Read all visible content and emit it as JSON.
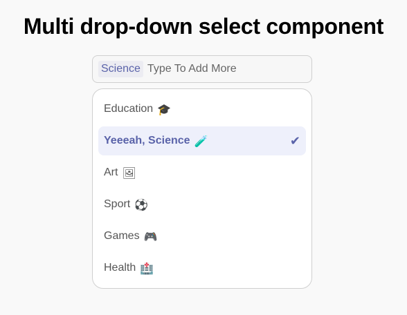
{
  "title": "Multi drop-down select component",
  "select": {
    "chips": [
      "Science"
    ],
    "placeholder": "Type To Add More"
  },
  "options": [
    {
      "label": "Education",
      "emoji": "🎓",
      "selected": false
    },
    {
      "label": "Yeeeah, Science",
      "emoji": "🧪",
      "selected": true
    },
    {
      "label": "Art",
      "emoji": "🖼",
      "selected": false
    },
    {
      "label": "Sport",
      "emoji": "⚽",
      "selected": false
    },
    {
      "label": "Games",
      "emoji": "🎮",
      "selected": false
    },
    {
      "label": "Health",
      "emoji": "🏥",
      "selected": false
    }
  ],
  "check_glyph": "✔",
  "colors": {
    "accent": "#5a63a9",
    "selected_bg": "#eef0fb",
    "chip_bg": "#ececf2"
  }
}
